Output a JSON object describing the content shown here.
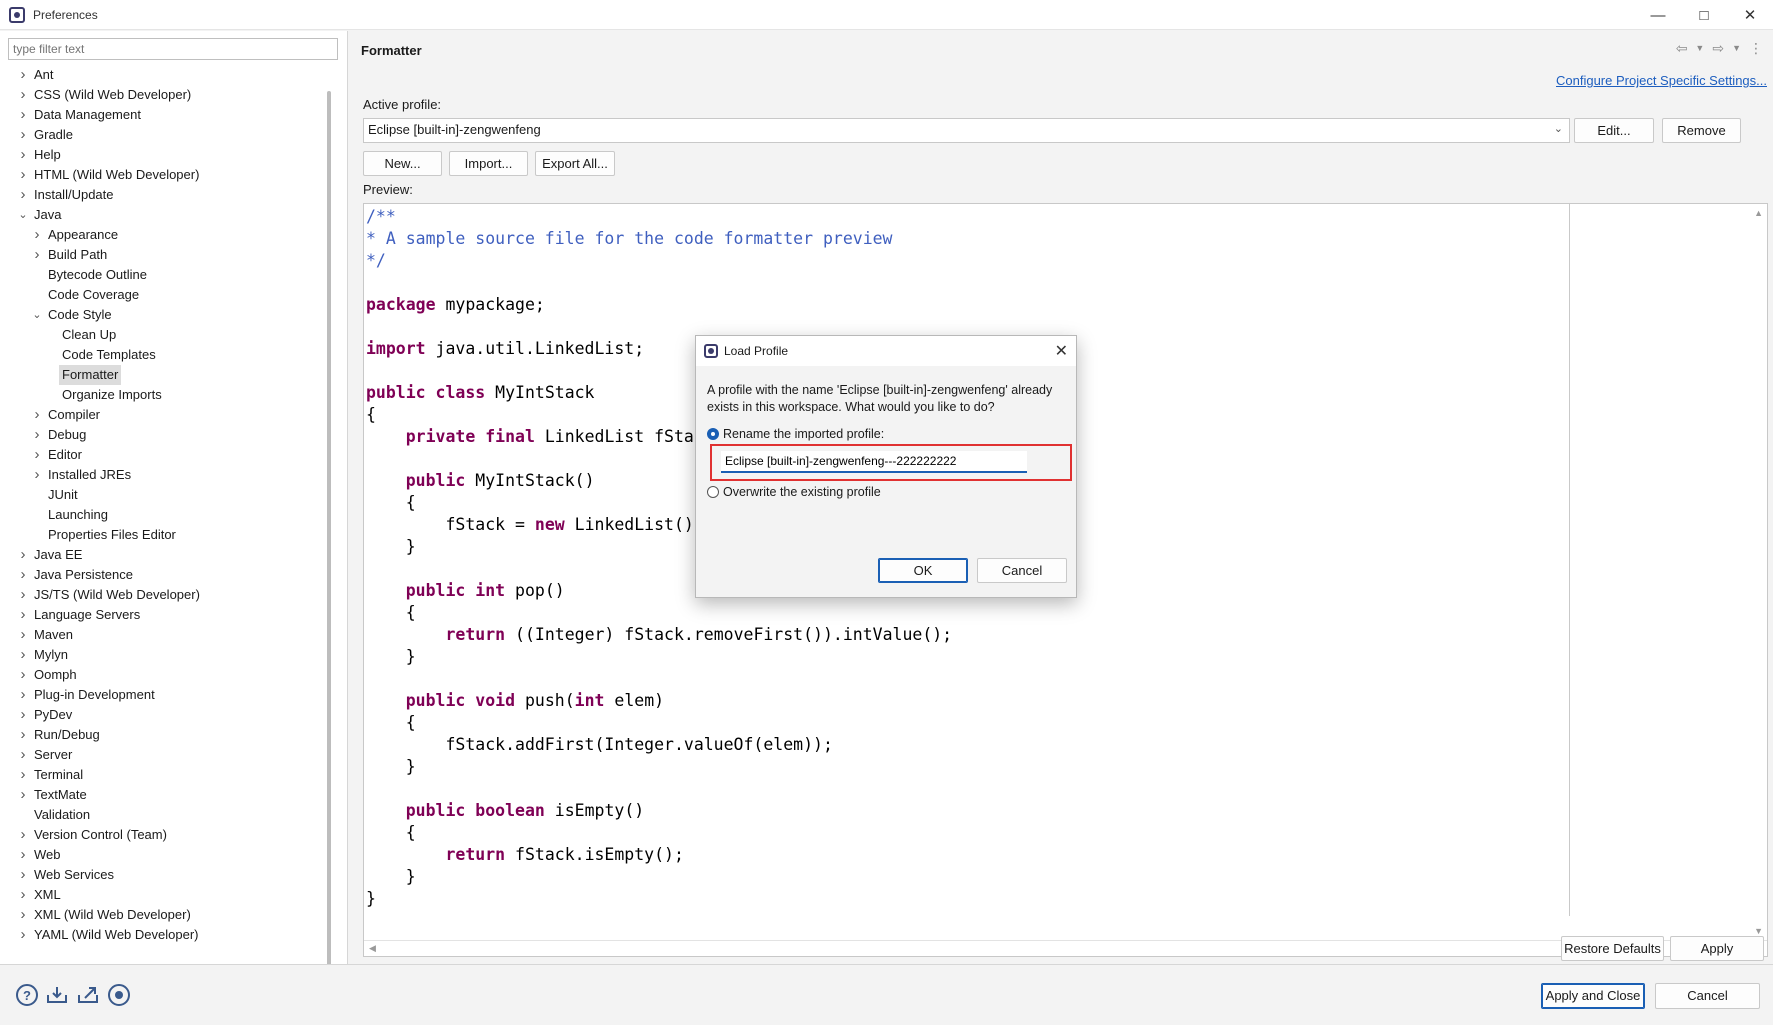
{
  "window": {
    "title": "Preferences"
  },
  "filter": {
    "placeholder": "type filter text"
  },
  "tree": [
    {
      "label": "Ant",
      "level": 0,
      "expander": "collapsed"
    },
    {
      "label": "CSS (Wild Web Developer)",
      "level": 0,
      "expander": "collapsed"
    },
    {
      "label": "Data Management",
      "level": 0,
      "expander": "collapsed"
    },
    {
      "label": "Gradle",
      "level": 0,
      "expander": "collapsed"
    },
    {
      "label": "Help",
      "level": 0,
      "expander": "collapsed"
    },
    {
      "label": "HTML (Wild Web Developer)",
      "level": 0,
      "expander": "collapsed"
    },
    {
      "label": "Install/Update",
      "level": 0,
      "expander": "collapsed"
    },
    {
      "label": "Java",
      "level": 0,
      "expander": "expanded"
    },
    {
      "label": "Appearance",
      "level": 1,
      "expander": "collapsed"
    },
    {
      "label": "Build Path",
      "level": 1,
      "expander": "collapsed"
    },
    {
      "label": "Bytecode Outline",
      "level": 1,
      "expander": "none"
    },
    {
      "label": "Code Coverage",
      "level": 1,
      "expander": "none"
    },
    {
      "label": "Code Style",
      "level": 1,
      "expander": "expanded"
    },
    {
      "label": "Clean Up",
      "level": 2,
      "expander": "none"
    },
    {
      "label": "Code Templates",
      "level": 2,
      "expander": "none"
    },
    {
      "label": "Formatter",
      "level": 2,
      "expander": "none",
      "selected": true
    },
    {
      "label": "Organize Imports",
      "level": 2,
      "expander": "none"
    },
    {
      "label": "Compiler",
      "level": 1,
      "expander": "collapsed"
    },
    {
      "label": "Debug",
      "level": 1,
      "expander": "collapsed"
    },
    {
      "label": "Editor",
      "level": 1,
      "expander": "collapsed"
    },
    {
      "label": "Installed JREs",
      "level": 1,
      "expander": "collapsed"
    },
    {
      "label": "JUnit",
      "level": 1,
      "expander": "none"
    },
    {
      "label": "Launching",
      "level": 1,
      "expander": "none"
    },
    {
      "label": "Properties Files Editor",
      "level": 1,
      "expander": "none"
    },
    {
      "label": "Java EE",
      "level": 0,
      "expander": "collapsed"
    },
    {
      "label": "Java Persistence",
      "level": 0,
      "expander": "collapsed"
    },
    {
      "label": "JS/TS (Wild Web Developer)",
      "level": 0,
      "expander": "collapsed"
    },
    {
      "label": "Language Servers",
      "level": 0,
      "expander": "collapsed"
    },
    {
      "label": "Maven",
      "level": 0,
      "expander": "collapsed"
    },
    {
      "label": "Mylyn",
      "level": 0,
      "expander": "collapsed"
    },
    {
      "label": "Oomph",
      "level": 0,
      "expander": "collapsed"
    },
    {
      "label": "Plug-in Development",
      "level": 0,
      "expander": "collapsed"
    },
    {
      "label": "PyDev",
      "level": 0,
      "expander": "collapsed"
    },
    {
      "label": "Run/Debug",
      "level": 0,
      "expander": "collapsed"
    },
    {
      "label": "Server",
      "level": 0,
      "expander": "collapsed"
    },
    {
      "label": "Terminal",
      "level": 0,
      "expander": "collapsed"
    },
    {
      "label": "TextMate",
      "level": 0,
      "expander": "collapsed"
    },
    {
      "label": "Validation",
      "level": 0,
      "expander": "none"
    },
    {
      "label": "Version Control (Team)",
      "level": 0,
      "expander": "collapsed"
    },
    {
      "label": "Web",
      "level": 0,
      "expander": "collapsed"
    },
    {
      "label": "Web Services",
      "level": 0,
      "expander": "collapsed"
    },
    {
      "label": "XML",
      "level": 0,
      "expander": "collapsed"
    },
    {
      "label": "XML (Wild Web Developer)",
      "level": 0,
      "expander": "collapsed"
    },
    {
      "label": "YAML (Wild Web Developer)",
      "level": 0,
      "expander": "collapsed"
    }
  ],
  "page": {
    "title": "Formatter",
    "config_link": "Configure Project Specific Settings...",
    "active_profile_label": "Active profile:",
    "active_profile_value": "Eclipse [built-in]-zengwenfeng",
    "edit_label": "Edit...",
    "remove_label": "Remove",
    "new_label": "New...",
    "import_label": "Import...",
    "export_label": "Export All...",
    "preview_label": "Preview:",
    "restore_label": "Restore Defaults",
    "apply_label": "Apply"
  },
  "code_lines": [
    [
      {
        "t": "/**",
        "c": "cm"
      }
    ],
    [
      {
        "t": "* A sample source file for the code formatter preview",
        "c": "cm"
      }
    ],
    [
      {
        "t": "*/",
        "c": "cm"
      }
    ],
    [],
    [
      {
        "t": "package",
        "c": "kw"
      },
      {
        "t": " mypackage;",
        "c": "pl"
      }
    ],
    [],
    [
      {
        "t": "import",
        "c": "kw"
      },
      {
        "t": " java.util.LinkedList;",
        "c": "pl"
      }
    ],
    [],
    [
      {
        "t": "public",
        "c": "kw"
      },
      {
        "t": " ",
        "c": "pl"
      },
      {
        "t": "class",
        "c": "kw"
      },
      {
        "t": " MyIntStack",
        "c": "pl"
      }
    ],
    [
      {
        "t": "{",
        "c": "pl"
      }
    ],
    [
      {
        "t": "    ",
        "c": "pl"
      },
      {
        "t": "private",
        "c": "kw"
      },
      {
        "t": " ",
        "c": "pl"
      },
      {
        "t": "final",
        "c": "kw"
      },
      {
        "t": " LinkedList fStack;",
        "c": "pl"
      }
    ],
    [],
    [
      {
        "t": "    ",
        "c": "pl"
      },
      {
        "t": "public",
        "c": "kw"
      },
      {
        "t": " MyIntStack()",
        "c": "pl"
      }
    ],
    [
      {
        "t": "    {",
        "c": "pl"
      }
    ],
    [
      {
        "t": "        fStack = ",
        "c": "pl"
      },
      {
        "t": "new",
        "c": "kw"
      },
      {
        "t": " LinkedList();",
        "c": "pl"
      }
    ],
    [
      {
        "t": "    }",
        "c": "pl"
      }
    ],
    [],
    [
      {
        "t": "    ",
        "c": "pl"
      },
      {
        "t": "public",
        "c": "kw"
      },
      {
        "t": " ",
        "c": "pl"
      },
      {
        "t": "int",
        "c": "kw"
      },
      {
        "t": " pop()",
        "c": "pl"
      }
    ],
    [
      {
        "t": "    {",
        "c": "pl"
      }
    ],
    [
      {
        "t": "        ",
        "c": "pl"
      },
      {
        "t": "return",
        "c": "kw"
      },
      {
        "t": " ((Integer) fStack.removeFirst()).intValue();",
        "c": "pl"
      }
    ],
    [
      {
        "t": "    }",
        "c": "pl"
      }
    ],
    [],
    [
      {
        "t": "    ",
        "c": "pl"
      },
      {
        "t": "public",
        "c": "kw"
      },
      {
        "t": " ",
        "c": "pl"
      },
      {
        "t": "void",
        "c": "kw"
      },
      {
        "t": " push(",
        "c": "pl"
      },
      {
        "t": "int",
        "c": "kw"
      },
      {
        "t": " elem)",
        "c": "pl"
      }
    ],
    [
      {
        "t": "    {",
        "c": "pl"
      }
    ],
    [
      {
        "t": "        fStack.addFirst(Integer.valueOf(elem));",
        "c": "pl"
      }
    ],
    [
      {
        "t": "    }",
        "c": "pl"
      }
    ],
    [],
    [
      {
        "t": "    ",
        "c": "pl"
      },
      {
        "t": "public",
        "c": "kw"
      },
      {
        "t": " ",
        "c": "pl"
      },
      {
        "t": "boolean",
        "c": "kw"
      },
      {
        "t": " isEmpty()",
        "c": "pl"
      }
    ],
    [
      {
        "t": "    {",
        "c": "pl"
      }
    ],
    [
      {
        "t": "        ",
        "c": "pl"
      },
      {
        "t": "return",
        "c": "kw"
      },
      {
        "t": " fStack.isEmpty();",
        "c": "pl"
      }
    ],
    [
      {
        "t": "    }",
        "c": "pl"
      }
    ],
    [
      {
        "t": "}",
        "c": "pl"
      }
    ]
  ],
  "footer": {
    "apply_close_label": "Apply and Close",
    "cancel_label": "Cancel",
    "icons": [
      "help-icon",
      "import-icon",
      "export-icon",
      "record-icon"
    ]
  },
  "dialog": {
    "title": "Load Profile",
    "message": "A profile with the name 'Eclipse [built-in]-zengwenfeng' already exists in this workspace. What would you like to do?",
    "rename_label": "Rename the imported profile:",
    "rename_selected": true,
    "new_name": "Eclipse [built-in]-zengwenfeng---222222222",
    "overwrite_label": "Overwrite the existing profile",
    "ok_label": "OK",
    "cancel_label": "Cancel"
  }
}
